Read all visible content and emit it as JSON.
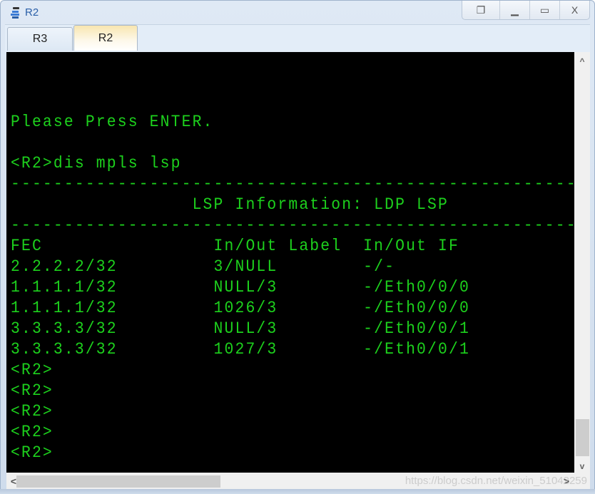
{
  "window": {
    "title": "R2",
    "app_icon": "network-device-icon",
    "controls": [
      {
        "name": "restore-layout-button",
        "icon": "cascade-windows-icon",
        "glyph": "❐"
      },
      {
        "name": "minimize-button",
        "icon": "minimize-icon",
        "glyph": "▁"
      },
      {
        "name": "maximize-button",
        "icon": "maximize-icon",
        "glyph": "▭"
      },
      {
        "name": "close-button",
        "icon": "close-icon",
        "glyph": "X"
      }
    ]
  },
  "tabs": [
    {
      "label": "R3",
      "active": false
    },
    {
      "label": "R2",
      "active": true
    }
  ],
  "terminal": {
    "lines": [
      "Please Press ENTER.",
      "",
      "<R2>dis mpls lsp",
      "--------------------------------------------------------",
      "                 LSP Information: LDP LSP",
      "--------------------------------------------------------",
      "FEC                In/Out Label  In/Out IF",
      "2.2.2.2/32         3/NULL        -/-",
      "1.1.1.1/32         NULL/3        -/Eth0/0/0",
      "1.1.1.1/32         1026/3        -/Eth0/0/0",
      "3.3.3.3/32         NULL/3        -/Eth0/0/1",
      "3.3.3.3/32         1027/3        -/Eth0/0/1",
      "<R2>",
      "<R2>",
      "<R2>",
      "<R2>",
      "<R2>"
    ],
    "text_color": "#1dd11d",
    "background": "#000000"
  },
  "scrollbars": {
    "vertical": {
      "up_glyph": "^",
      "down_glyph": "v",
      "position": "bottom"
    },
    "horizontal": {
      "left_glyph": "<",
      "right_glyph": ">",
      "position": "left"
    }
  },
  "watermark": "https://blog.csdn.net/weixin_51042259"
}
